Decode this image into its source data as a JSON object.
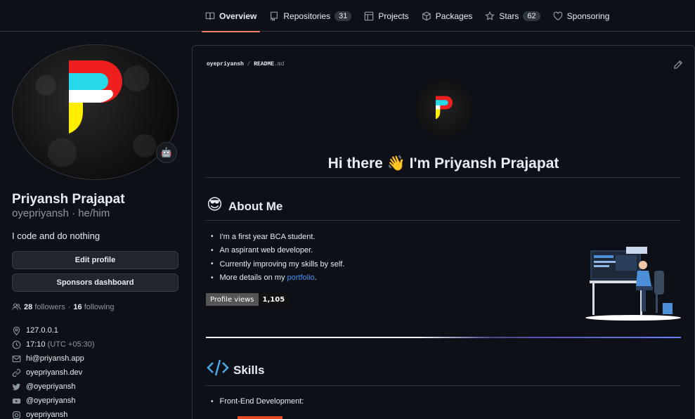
{
  "nav": {
    "tabs": [
      {
        "label": "Overview",
        "icon": "book-icon",
        "selected": true
      },
      {
        "label": "Repositories",
        "icon": "repo-icon",
        "count": "31"
      },
      {
        "label": "Projects",
        "icon": "table-icon"
      },
      {
        "label": "Packages",
        "icon": "package-icon"
      },
      {
        "label": "Stars",
        "icon": "star-icon",
        "count": "62"
      },
      {
        "label": "Sponsoring",
        "icon": "heart-icon"
      }
    ]
  },
  "profile": {
    "full_name": "Priyansh Prajapat",
    "login": "oyepriyansh",
    "pronouns": "he/him",
    "login_line": "oyepriyansh · he/him",
    "status_emoji": "🤖",
    "bio": "I code and do nothing",
    "edit_button": "Edit profile",
    "sponsors_button": "Sponsors dashboard",
    "followers": "28",
    "followers_label": "followers",
    "following": "16",
    "following_label": "following",
    "separator": "·",
    "location": "127.0.0.1",
    "time": "17:10",
    "timezone": "(UTC +05:30)",
    "email": "hi@priyansh.app",
    "website": "oyepriyansh.dev",
    "twitter": "@oyepriyansh",
    "youtube": "@oyepriyansh",
    "instagram": "oyepriyansh"
  },
  "readme": {
    "path_user": "oyepriyansh",
    "path_sep": " / ",
    "path_file": "README",
    "path_ext": ".md",
    "greeting": "Hi there 👋 I'm Priyansh Prajapat",
    "about_emoji": "😎",
    "about_title": "About Me",
    "about_items": [
      "I'm a first year BCA student.",
      "An aspirant web developer.",
      "Currently improving my skills by self."
    ],
    "portfolio_prefix": "More details on my ",
    "portfolio_link": "portfolio",
    "portfolio_suffix": ".",
    "badge_label": "Profile views",
    "badge_value": "1,105",
    "skills_title": "Skills",
    "skills_items": [
      "Front-End Development:"
    ]
  },
  "colors": {
    "background": "#0d1117",
    "border": "#30363d",
    "accent": "#f78166",
    "link": "#4493f8",
    "muted": "#8d96a0"
  }
}
